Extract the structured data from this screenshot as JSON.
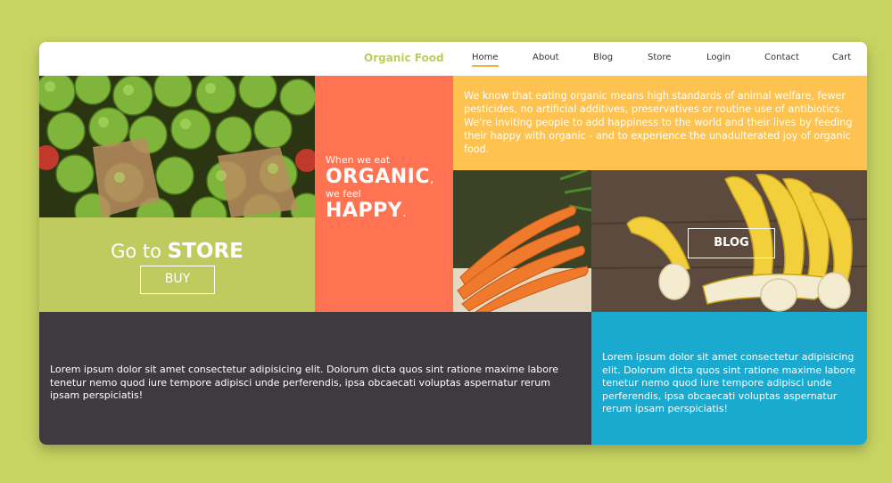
{
  "header": {
    "brand": "Organic Food",
    "nav": [
      {
        "label": "Home",
        "active": true
      },
      {
        "label": "About"
      },
      {
        "label": "Blog"
      },
      {
        "label": "Store"
      },
      {
        "label": "Login"
      },
      {
        "label": "Contact"
      },
      {
        "label": "Cart"
      }
    ]
  },
  "store_tile": {
    "title_prefix": "Go to ",
    "title_strong": "STORE",
    "buy_label": "BUY"
  },
  "organic_tile": {
    "line1": "When we eat",
    "word1": "ORGANIC",
    "punct1": ",",
    "line2": "we feel",
    "word2": "HAPPY",
    "punct2": "."
  },
  "intro_text": "We know that eating organic means high standards of animal welfare, fewer pesticides, no artificial additives, preservatives or routine use of antibiotics. We're inviting people to add happiness to the world and their lives by feeding their happy with organic - and to experience the unadulterated joy of organic food.",
  "blog_tile": {
    "label": "BLOG"
  },
  "dark_text": "Lorem ipsum dolor sit amet consectetur adipisicing elit. Dolorum dicta quos sint ratione maxime labore tenetur nemo quod iure tempore adipisci unde perferendis, ipsa obcaecati voluptas aspernatur rerum ipsam perspiciatis!",
  "blue_text": "Lorem ipsum dolor sit amet consectetur adipisicing elit. Dolorum dicta quos sint ratione maxime labore tenetur nemo quod iure tempore adipisci unde perferendis, ipsa obcaecati voluptas aspernatur rerum ipsam perspiciatis!",
  "colors": {
    "page_bg": "#c8d462",
    "brand": "#c0cc5a",
    "nav_active_underline": "#f2b344",
    "store_green": "#bfcb5f",
    "organic_coral": "#ff7352",
    "intro_yellow": "#fdc24f",
    "dark_panel": "#3e3b3f",
    "blue_panel": "#1aa9cf"
  },
  "images": [
    "green-apples-photo",
    "carrots-photo",
    "bananas-photo"
  ]
}
